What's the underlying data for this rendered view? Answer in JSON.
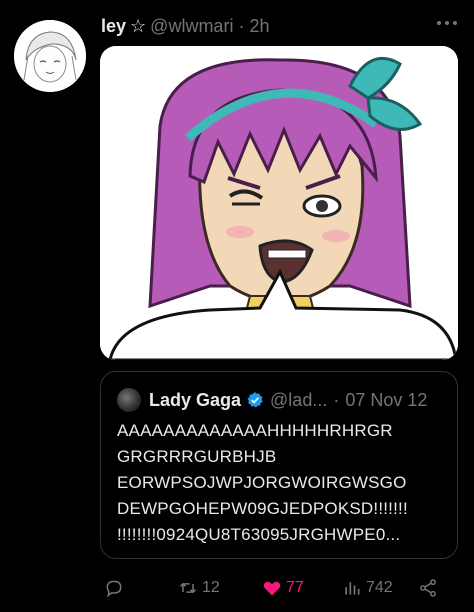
{
  "post": {
    "display_name": "ley",
    "name_symbol": "☆",
    "handle": "@wlwmari",
    "separator": "·",
    "time": "2h",
    "more_icon": "more-dots-icon"
  },
  "quote": {
    "display_name": "Lady Gaga",
    "handle": "@lad...",
    "separator": "·",
    "date": "07 Nov 12",
    "text_lines": [
      "AAAAAAAAAAAAAHHHHHRHRGR",
      "GRGRRRGURBHJB",
      "EORWPSOJWPJORGWOIRGWSGO",
      "DEWPGOHEPW09GJEDPOKSD!!!!!!!",
      "!!!!!!!!0924QU8T63095JRGHWPE0..."
    ]
  },
  "actions": {
    "reply_count": "",
    "retweet_count": "12",
    "like_count": "77",
    "views_count": "742"
  },
  "colors": {
    "like_active": "#f91880",
    "muted": "#71767b",
    "verified": "#1d9bf0",
    "hair": "#b65bb8",
    "bow": "#3fb8b8"
  }
}
